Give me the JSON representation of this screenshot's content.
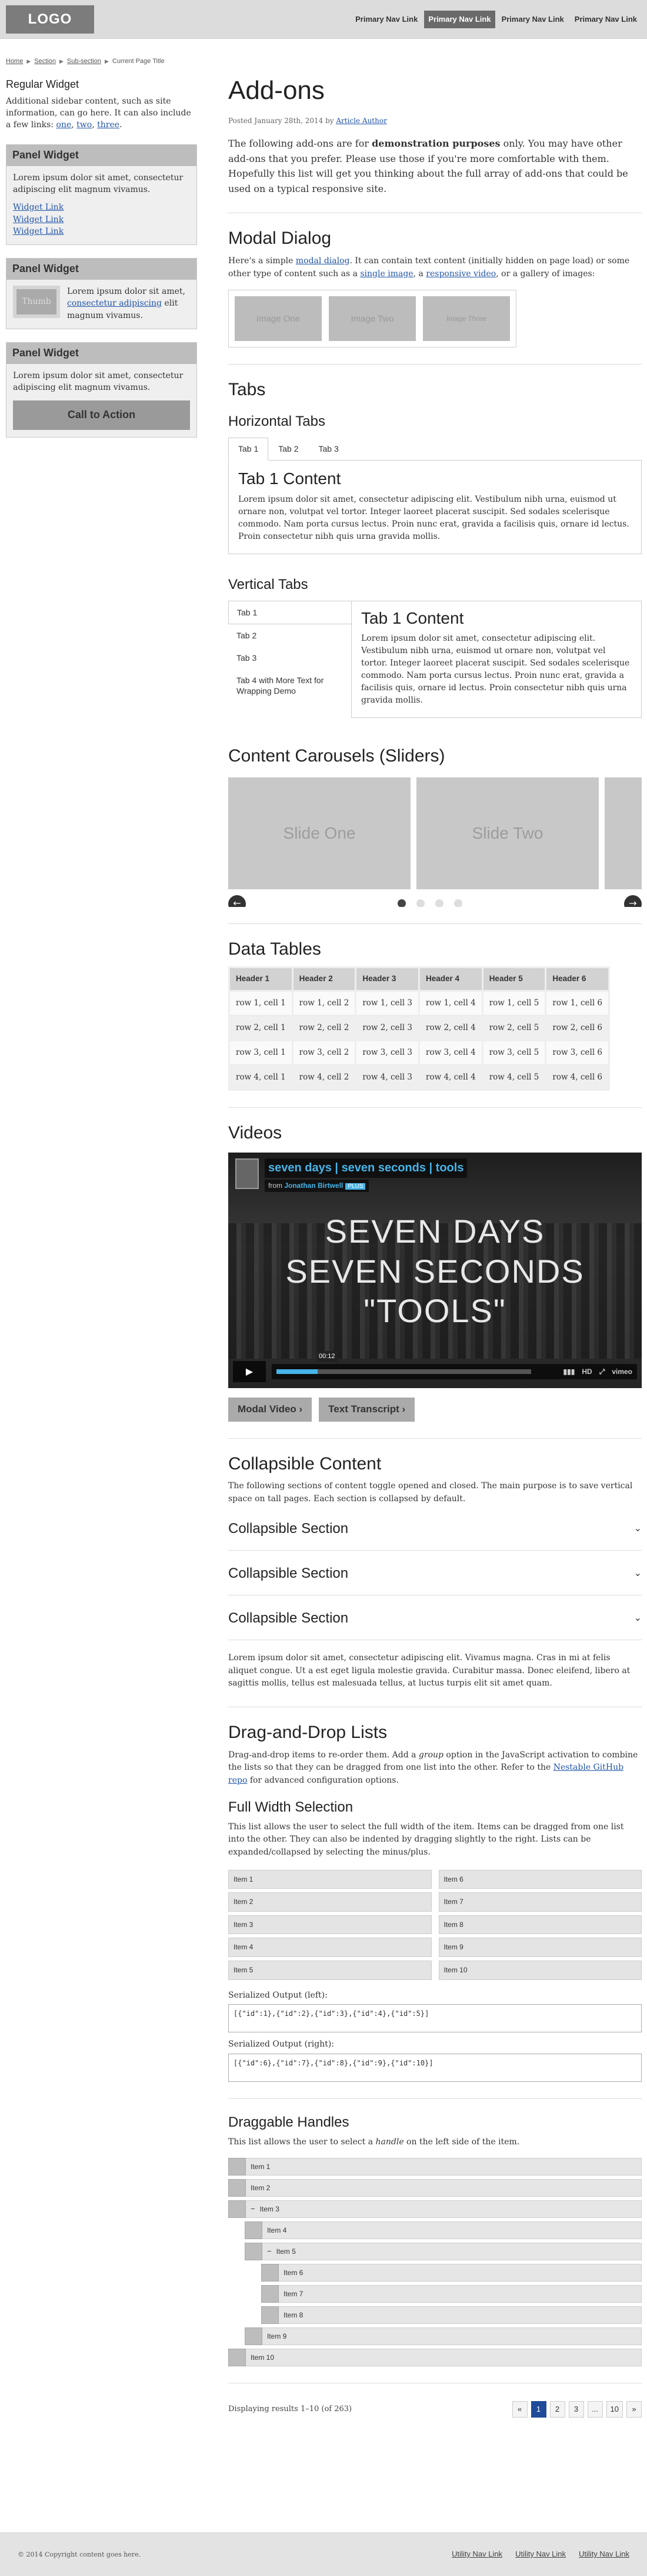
{
  "header": {
    "logo": "LOGO",
    "nav": [
      "Primary Nav Link",
      "Primary Nav Link",
      "Primary Nav Link",
      "Primary Nav Link"
    ]
  },
  "breadcrumb": [
    "Home",
    "Section",
    "Sub-section",
    "Current Page Title"
  ],
  "sidebar": {
    "title": "Regular Widget",
    "text": "Additional sidebar content, such as site information, can go here. It can also include a few links: ",
    "links": [
      "one",
      "two",
      "three"
    ],
    "panel1": {
      "title": "Panel Widget",
      "text": "Lorem ipsum dolor sit amet, consectetur adipiscing elit magnum vivamus.",
      "links": [
        "Widget Link",
        "Widget Link",
        "Widget Link"
      ]
    },
    "panel2": {
      "title": "Panel Widget",
      "thumb": "Thumb",
      "text_pre": "Lorem ipsum dolor sit amet, ",
      "link": "consectetur adipiscing",
      "text_post": " elit magnum vivamus."
    },
    "panel3": {
      "title": "Panel Widget",
      "text": "Lorem ipsum dolor sit amet, consectetur adipiscing elit magnum vivamus.",
      "cta": "Call to Action"
    }
  },
  "main": {
    "title": "Add-ons",
    "posted_pre": "Posted January 28th, 2014 by ",
    "author": "Article Author",
    "intro_pre": "The following add-ons are for ",
    "intro_bold": "demonstration purposes",
    "intro_post": " only. You may have other add-ons that you prefer. Please use those if you're more comfortable with them. Hopefully this list will get you thinking about the full array of add-ons that could be used on a typical responsive site.",
    "modal": {
      "title": "Modal Dialog",
      "t1": "Here's a simple ",
      "l1": "modal dialog",
      "t2": ". It can contain text content (initially hidden on page load) or some other type of content such as a ",
      "l2": "single image",
      "t3": ", a ",
      "l3": "responsive video",
      "t4": ", or a gallery of images:",
      "gallery": [
        "Image One",
        "Image Two",
        "Image Three"
      ]
    },
    "tabs": {
      "title": "Tabs",
      "htitle": "Horizontal Tabs",
      "htabs": [
        "Tab 1",
        "Tab 2",
        "Tab 3"
      ],
      "content_title": "Tab 1 Content",
      "content": "Lorem ipsum dolor sit amet, consectetur adipiscing elit. Vestibulum nibh urna, euismod ut ornare non, volutpat vel tortor. Integer laoreet placerat suscipit. Sed sodales scelerisque commodo. Nam porta cursus lectus. Proin nunc erat, gravida a facilisis quis, ornare id lectus. Proin consectetur nibh quis urna gravida mollis.",
      "vtitle": "Vertical Tabs",
      "vtabs": [
        "Tab 1",
        "Tab 2",
        "Tab 3",
        "Tab 4 with More Text for Wrapping Demo"
      ]
    },
    "carousel": {
      "title": "Content Carousels (Sliders)",
      "slides": [
        "Slide One",
        "Slide Two"
      ]
    },
    "tables": {
      "title": "Data Tables",
      "headers": [
        "Header 1",
        "Header 2",
        "Header 3",
        "Header 4",
        "Header 5",
        "Header 6"
      ],
      "rows": [
        [
          "row 1, cell 1",
          "row 1, cell 2",
          "row 1, cell 3",
          "row 1, cell 4",
          "row 1, cell 5",
          "row 1, cell 6"
        ],
        [
          "row 2, cell 1",
          "row 2, cell 2",
          "row 2, cell 3",
          "row 2, cell 4",
          "row 2, cell 5",
          "row 2, cell 6"
        ],
        [
          "row 3, cell 1",
          "row 3, cell 2",
          "row 3, cell 3",
          "row 3, cell 4",
          "row 3, cell 5",
          "row 3, cell 6"
        ],
        [
          "row 4, cell 1",
          "row 4, cell 2",
          "row 4, cell 3",
          "row 4, cell 4",
          "row 4, cell 5",
          "row 4, cell 6"
        ]
      ]
    },
    "videos": {
      "title": "Videos",
      "video_title": "seven days | seven seconds | tools",
      "from": "from ",
      "author": "Jonathan Birtwell",
      "plus": "PLUS",
      "big_text": [
        "SEVEN DAYS",
        "SEVEN SECONDS",
        "\"TOOLS\""
      ],
      "time": "00:12",
      "hd": "HD",
      "brand": "vimeo",
      "buttons": [
        "Modal Video ›",
        "Text Transcript ›"
      ]
    },
    "collapsible": {
      "title": "Collapsible Content",
      "intro": "The following sections of content toggle opened and closed. The main purpose is to save vertical space on tall pages. Each section is collapsed by default.",
      "sections": [
        "Collapsible Section",
        "Collapsible Section",
        "Collapsible Section"
      ],
      "body": "Lorem ipsum dolor sit amet, consectetur adipiscing elit. Vivamus magna. Cras in mi at felis aliquet congue. Ut a est eget ligula molestie gravida. Curabitur massa. Donec eleifend, libero at sagittis mollis, tellus est malesuada tellus, at luctus turpis elit sit amet quam."
    },
    "dnd": {
      "title": "Drag-and-Drop Lists",
      "t1": "Drag-and-drop items to re-order them. Add a ",
      "em": "group",
      "t2": " option in the JavaScript activation to combine the lists so that they can be dragged from one list into the other. Refer to the ",
      "link": "Nestable GitHub repo",
      "t3": " for advanced configuration options.",
      "fw_title": "Full Width Selection",
      "fw_text": "This list allows the user to select the full width of the item. Items can be dragged from one list into the other. They can also be indented by dragging slightly to the right. Lists can be expanded/collapsed by selecting the minus/plus.",
      "left": [
        "Item 1",
        "Item 2",
        "Item 3",
        "Item 4",
        "Item 5"
      ],
      "right": [
        "Item 6",
        "Item 7",
        "Item 8",
        "Item 9",
        "Item 10"
      ],
      "out_left_label": "Serialized Output (left):",
      "out_left": "[{\"id\":1},{\"id\":2},{\"id\":3},{\"id\":4},{\"id\":5}]",
      "out_right_label": "Serialized Output (right):",
      "out_right": "[{\"id\":6},{\"id\":7},{\"id\":8},{\"id\":9},{\"id\":10}]",
      "dh_title": "Draggable Handles",
      "dh_t1": "This list allows the user to select a ",
      "dh_em": "handle",
      "dh_t2": " on the left side of the item.",
      "handles": [
        {
          "label": "Item 1",
          "level": 0,
          "minus": false
        },
        {
          "label": "Item 2",
          "level": 0,
          "minus": false
        },
        {
          "label": "Item 3",
          "level": 0,
          "minus": true
        },
        {
          "label": "Item 4",
          "level": 1,
          "minus": false
        },
        {
          "label": "Item 5",
          "level": 1,
          "minus": true
        },
        {
          "label": "Item 6",
          "level": 2,
          "minus": false
        },
        {
          "label": "Item 7",
          "level": 2,
          "minus": false
        },
        {
          "label": "Item 8",
          "level": 2,
          "minus": false
        },
        {
          "label": "Item 9",
          "level": 1,
          "minus": false
        },
        {
          "label": "Item 10",
          "level": 0,
          "minus": false
        }
      ]
    },
    "pager": {
      "label": "Displaying results 1–10 (of 263)",
      "pages": [
        "«",
        "1",
        "2",
        "3",
        "...",
        "10",
        "»"
      ],
      "active": "1"
    }
  },
  "footer": {
    "copyright": "© 2014 Copyright content goes here.",
    "links": [
      "Utility Nav Link",
      "Utility Nav Link",
      "Utility Nav Link"
    ]
  }
}
